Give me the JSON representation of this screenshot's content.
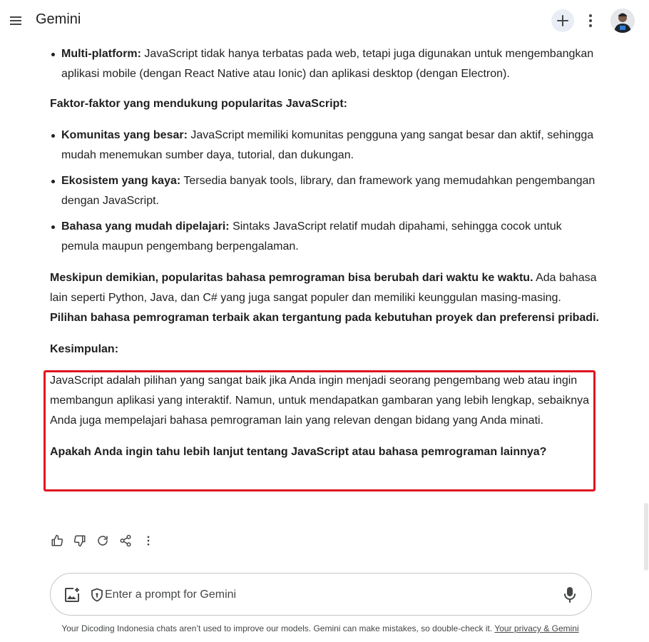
{
  "header": {
    "title": "Gemini",
    "menu_icon": "hamburger-menu-icon",
    "new_chat_icon": "plus-icon",
    "more_icon": "more-vert-icon",
    "avatar": "user-avatar"
  },
  "response": {
    "bullet_1": {
      "label": "Multi-platform:",
      "text": " JavaScript tidak hanya terbatas pada web, tetapi juga digunakan untuk mengembangkan aplikasi mobile (dengan React Native atau Ionic) dan aplikasi desktop (dengan Electron)."
    },
    "factors_heading": "Faktor-faktor yang mendukung popularitas JavaScript:",
    "factors": [
      {
        "label": "Komunitas yang besar:",
        "text": " JavaScript memiliki komunitas pengguna yang sangat besar dan aktif, sehingga mudah menemukan sumber daya, tutorial, dan dukungan."
      },
      {
        "label": "Ekosistem yang kaya:",
        "text": " Tersedia banyak tools, library, dan framework yang memudahkan pengembangan dengan JavaScript."
      },
      {
        "label": "Bahasa yang mudah dipelajari:",
        "text": " Sintaks JavaScript relatif mudah dipahami, sehingga cocok untuk pemula maupun pengembang berpengalaman."
      }
    ],
    "para": {
      "bold_1": "Meskipun demikian, popularitas bahasa pemrograman bisa berubah dari waktu ke waktu.",
      "normal": " Ada bahasa lain seperti Python, Java, dan C# yang juga sangat populer dan memiliki keunggulan masing-masing. ",
      "bold_2": "Pilihan bahasa pemrograman terbaik akan tergantung pada kebutuhan proyek dan preferensi pribadi."
    },
    "conclusion_heading": "Kesimpulan:",
    "conclusion_text": "JavaScript adalah pilihan yang sangat baik jika Anda ingin menjadi seorang pengembang web atau ingin membangun aplikasi yang interaktif. Namun, untuk mendapatkan gambaran yang lebih lengkap, sebaiknya Anda juga mempelajari bahasa pemrograman lain yang relevan dengan bidang yang Anda minati.",
    "closing_question": "Apakah Anda ingin tahu lebih lanjut tentang JavaScript atau bahasa pemrograman lainnya?"
  },
  "actions": [
    "thumbs-up-icon",
    "thumbs-down-icon",
    "regenerate-icon",
    "share-icon",
    "more-vert-icon"
  ],
  "prompt": {
    "placeholder": "Enter a prompt for Gemini"
  },
  "footer": {
    "text": "Your Dicoding Indonesia chats aren’t used to improve our models. Gemini can make mistakes, so double-check it. ",
    "link": "Your privacy & Gemini"
  }
}
